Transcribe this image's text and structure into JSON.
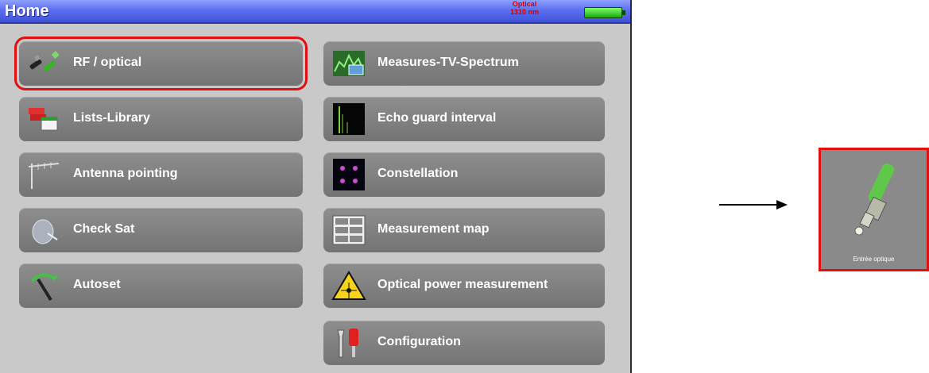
{
  "header": {
    "title": "Home",
    "status_line1": "Optical",
    "status_line2": "1310 nm"
  },
  "menu": {
    "left": [
      {
        "label": "RF / optical",
        "icon": "fiber-connector-icon",
        "selected": true
      },
      {
        "label": "Lists-Library",
        "icon": "library-icon"
      },
      {
        "label": "Antenna pointing",
        "icon": "antenna-icon"
      },
      {
        "label": "Check Sat",
        "icon": "satellite-dish-icon"
      },
      {
        "label": "Autoset",
        "icon": "autoset-icon"
      }
    ],
    "right": [
      {
        "label": "Measures-TV-Spectrum",
        "icon": "tv-spectrum-icon"
      },
      {
        "label": "Echo guard interval",
        "icon": "echo-icon"
      },
      {
        "label": "Constellation",
        "icon": "constellation-icon"
      },
      {
        "label": "Measurement map",
        "icon": "measurement-map-icon"
      },
      {
        "label": "Optical power measurement",
        "icon": "laser-warning-icon"
      },
      {
        "label": "Configuration",
        "icon": "wrench-icon"
      }
    ]
  },
  "callout": {
    "caption": "Entrée optique",
    "icon": "fiber-connector-icon"
  },
  "colors": {
    "highlight": "#e01010",
    "titlebar": "#4f62e6",
    "button": "#7f7f7f"
  }
}
